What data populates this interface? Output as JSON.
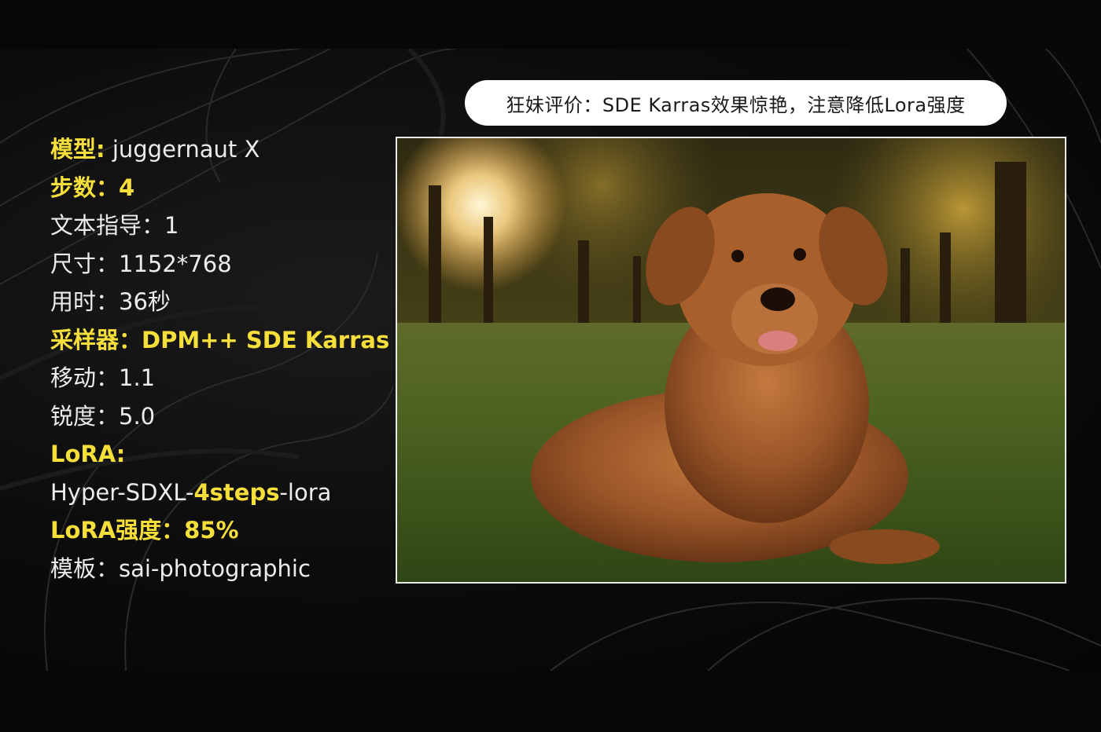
{
  "caption": "狂妹评价：SDE Karras效果惊艳，注意降低Lora强度",
  "params": {
    "model_label": "模型:",
    "model_value": " juggernaut X",
    "steps_text": "步数：4",
    "guidance_text": "文本指导：1",
    "size_text": "尺寸：1152*768",
    "time_text": "用时：36秒",
    "sampler_text": "采样器：DPM++ SDE Karras",
    "shift_text": "移动：1.1",
    "sharpness_text": "锐度：5.0",
    "lora_label": "LoRA:",
    "lora_name_prefix": "Hyper-SDXL-",
    "lora_name_highlight": "4steps",
    "lora_name_suffix": "-lora",
    "lora_strength_text": "LoRA强度：85%",
    "template_text": "模板：sai-photographic"
  },
  "image": {
    "subject": "dog-photo"
  },
  "colors": {
    "highlight": "#f6df3a",
    "text": "#ececec",
    "background": "#070707",
    "pill": "#ffffff"
  }
}
